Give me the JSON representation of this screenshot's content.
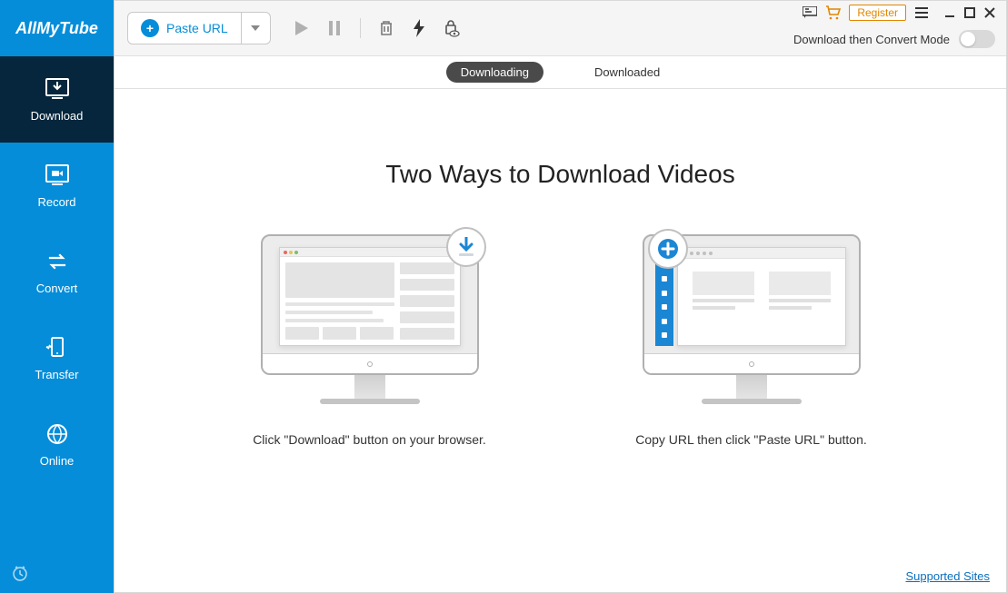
{
  "appName": "AllMyTube",
  "sidebar": {
    "items": [
      {
        "label": "Download",
        "active": true
      },
      {
        "label": "Record",
        "active": false
      },
      {
        "label": "Convert",
        "active": false
      },
      {
        "label": "Transfer",
        "active": false
      },
      {
        "label": "Online",
        "active": false
      }
    ]
  },
  "toolbar": {
    "pasteUrlLabel": "Paste URL"
  },
  "topRight": {
    "registerLabel": "Register",
    "modeLabel": "Download then Convert Mode"
  },
  "tabs": {
    "downloading": "Downloading",
    "downloaded": "Downloaded"
  },
  "content": {
    "title": "Two Ways to Download Videos",
    "method1Caption": "Click \"Download\" button on your browser.",
    "method2Caption": "Copy URL then click \"Paste URL\" button.",
    "supportedSitesLabel": "Supported Sites"
  }
}
